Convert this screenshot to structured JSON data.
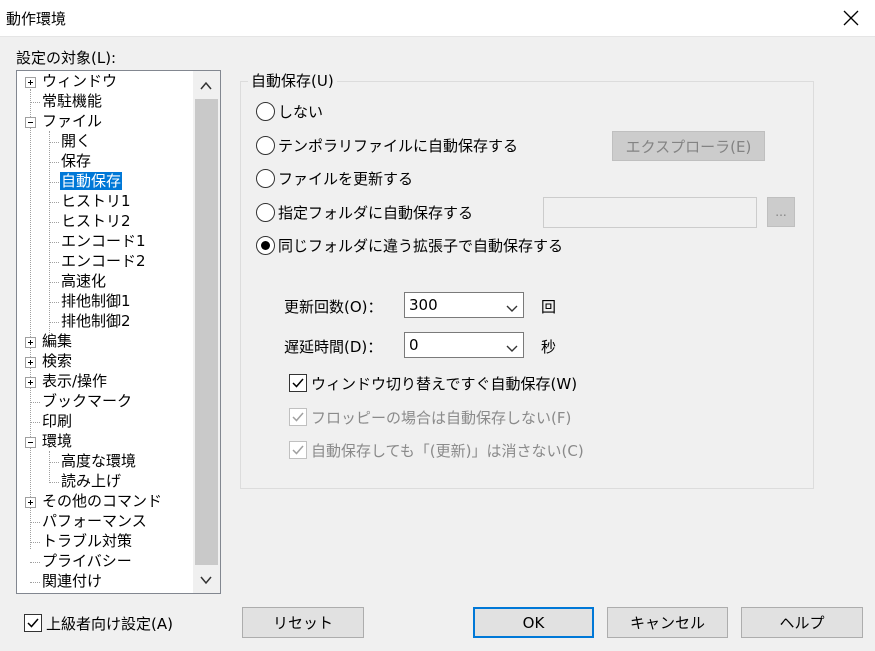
{
  "window": {
    "title": "動作環境"
  },
  "sidebar": {
    "label": "設定の対象(L):",
    "items": [
      {
        "label": "ウィンドウ"
      },
      {
        "label": "常駐機能"
      },
      {
        "label": "ファイル"
      },
      {
        "label": "開く"
      },
      {
        "label": "保存"
      },
      {
        "label": "自動保存"
      },
      {
        "label": "ヒストリ1"
      },
      {
        "label": "ヒストリ2"
      },
      {
        "label": "エンコード1"
      },
      {
        "label": "エンコード2"
      },
      {
        "label": "高速化"
      },
      {
        "label": "排他制御1"
      },
      {
        "label": "排他制御2"
      },
      {
        "label": "編集"
      },
      {
        "label": "検索"
      },
      {
        "label": "表示/操作"
      },
      {
        "label": "ブックマーク"
      },
      {
        "label": "印刷"
      },
      {
        "label": "環境"
      },
      {
        "label": "高度な環境"
      },
      {
        "label": "読み上げ"
      },
      {
        "label": "その他のコマンド"
      },
      {
        "label": "パフォーマンス"
      },
      {
        "label": "トラブル対策"
      },
      {
        "label": "プライバシー"
      },
      {
        "label": "関連付け"
      }
    ]
  },
  "autosave": {
    "group_title": "自動保存(U)",
    "options": [
      {
        "label": "しない"
      },
      {
        "label": "テンポラリファイルに自動保存する"
      },
      {
        "label": "ファイルを更新する"
      },
      {
        "label": "指定フォルダに自動保存する"
      },
      {
        "label": "同じフォルダに違う拡張子で自動保存する"
      }
    ],
    "explorer_button": "エクスプローラ(E)",
    "browse_button": "...",
    "update_count_label": "更新回数(O)：",
    "update_count_value": "300",
    "update_count_unit": "回",
    "delay_label": "遅延時間(D)：",
    "delay_value": "0",
    "delay_unit": "秒",
    "check_window_switch": "ウィンドウ切り替えですぐ自動保存(W)",
    "check_floppy": "フロッピーの場合は自動保存しない(F)",
    "check_keep_modified": "自動保存しても「(更新)」は消さない(C)"
  },
  "footer": {
    "advanced_label": "上級者向け設定(A)",
    "reset": "リセット",
    "ok": "OK",
    "cancel": "キャンセル",
    "help": "ヘルプ"
  },
  "colors": {
    "accent": "#0078d7",
    "face": "#f0f0f0"
  }
}
